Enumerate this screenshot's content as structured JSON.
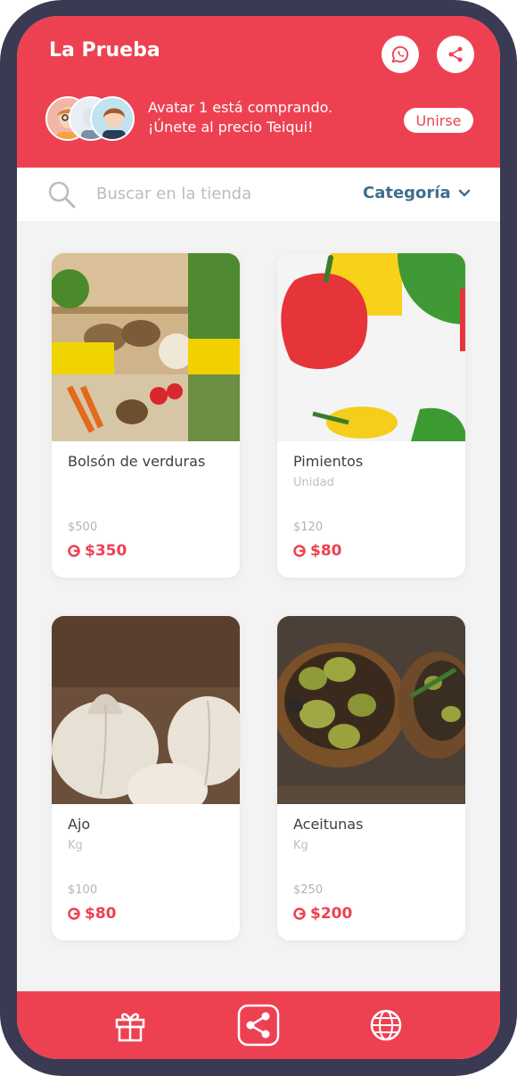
{
  "header": {
    "title": "La Prueba",
    "banner_line1": "Avatar 1 está comprando.",
    "banner_line2": "¡Únete al precio Teiqui!",
    "join_label": "Unirse"
  },
  "search": {
    "placeholder": "Buscar en la tienda",
    "category_label": "Categoría"
  },
  "products": [
    {
      "name": "Bolsón de verduras",
      "unit": "",
      "old_price": "$500",
      "price": "$350"
    },
    {
      "name": "Pimientos",
      "unit": "Unidad",
      "old_price": "$120",
      "price": "$80"
    },
    {
      "name": "Ajo",
      "unit": "Kg",
      "old_price": "$100",
      "price": "$80"
    },
    {
      "name": "Aceitunas",
      "unit": "Kg",
      "old_price": "$250",
      "price": "$200"
    }
  ],
  "footer": {
    "icons": [
      "gift-icon",
      "share-icon",
      "globe-icon"
    ]
  },
  "colors": {
    "brand": "#ed4152",
    "category": "#3f6e8f",
    "frame": "#3a3a52"
  }
}
